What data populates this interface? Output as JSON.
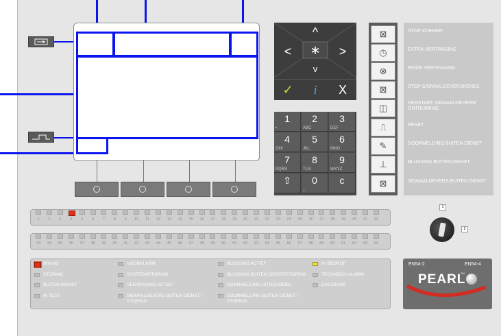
{
  "nav_keys": {
    "up": "^",
    "left": "<",
    "center": "∗",
    "right": ">",
    "down": "v",
    "ok": "✓",
    "info": "i",
    "cancel": "X"
  },
  "keypad": [
    {
      "digit": "1",
      "letters": "•"
    },
    {
      "digit": "2",
      "letters": "ABC"
    },
    {
      "digit": "3",
      "letters": "DEF"
    },
    {
      "digit": "4",
      "letters": "GHI"
    },
    {
      "digit": "5",
      "letters": "JKL"
    },
    {
      "digit": "6",
      "letters": "MNO"
    },
    {
      "digit": "7",
      "letters": "PQRS"
    },
    {
      "digit": "8",
      "letters": "TUV"
    },
    {
      "digit": "9",
      "letters": "WXYZ"
    },
    {
      "digit": "⇧",
      "letters": ""
    },
    {
      "digit": "0",
      "letters": "⎵"
    },
    {
      "digit": "c",
      "letters": ""
    }
  ],
  "function_labels": [
    "STOP ZOEMER",
    "EXTRA VERTRAGING",
    "EINDE VERTRAGING",
    "STOP SIGNAALGEVERSRENES",
    "HERSTART SIGNAALGEVERS/\nONTRUIMING",
    "RESET",
    "DOORMELDING BUITEN DIENST",
    "BLUSSING BUITEN DIENST",
    "SIGNAALGEVERS BUITEN DIENST"
  ],
  "zones_row1": [
    "1",
    "2",
    "3",
    "4",
    "5",
    "6",
    "7",
    "8",
    "9",
    "10",
    "11",
    "12",
    "13",
    "14",
    "15",
    "16",
    "17",
    "18",
    "19",
    "20",
    "21",
    "22",
    "23",
    "24",
    "25",
    "26",
    "27",
    "28",
    "29",
    "30",
    "31",
    "32"
  ],
  "zones_row2": [
    "33",
    "34",
    "35",
    "36",
    "37",
    "38",
    "39",
    "40",
    "41",
    "42",
    "43",
    "44",
    "45",
    "46",
    "47",
    "48",
    "49",
    "50",
    "51",
    "52",
    "53",
    "54",
    "55",
    "56",
    "57",
    "58",
    "59",
    "60",
    "61",
    "62",
    "63",
    "64"
  ],
  "active_zone_index": 3,
  "status_indicators": [
    {
      "label": "BRAND",
      "state": "red"
    },
    {
      "label": "STORING",
      "state": "off"
    },
    {
      "label": "BUITEN DIENST",
      "state": "off"
    },
    {
      "label": "IN TEST",
      "state": "off"
    },
    {
      "label": "VOORALARM",
      "state": "off"
    },
    {
      "label": "SYSTEEMSTORING",
      "state": "off"
    },
    {
      "label": "VERTRAGING ACTIEF",
      "state": "off"
    },
    {
      "label": "SIGNAALGEVERS BUITEN DIENST /\nSTORING",
      "state": "off"
    },
    {
      "label": "BLUSSING ACTIEF",
      "state": "off"
    },
    {
      "label": "BLUSSING BUITEN DIENST/STORING",
      "state": "off"
    },
    {
      "label": "DOORMELDING UITGEVOERD",
      "state": "off"
    },
    {
      "label": "DOORMELDING BUITEN DIENST /\nSTORING",
      "state": "off"
    },
    {
      "label": "IN BEDRIJF",
      "state": "yellow"
    },
    {
      "label": "TECHNISCH ALARM",
      "state": "off"
    },
    {
      "label": "DAGSTAND",
      "state": "off"
    }
  ],
  "logo": {
    "left": "EN54-2",
    "right": "EN54-4",
    "brand": "PEARL",
    "tm": "TM"
  },
  "key_switch": {
    "position_top": "1",
    "position_right": "2"
  },
  "colors": {
    "highlight": "#0a14ee",
    "led_red": "#e0301a",
    "led_yellow": "#e8e13a",
    "panel": "#e6e6e6"
  }
}
